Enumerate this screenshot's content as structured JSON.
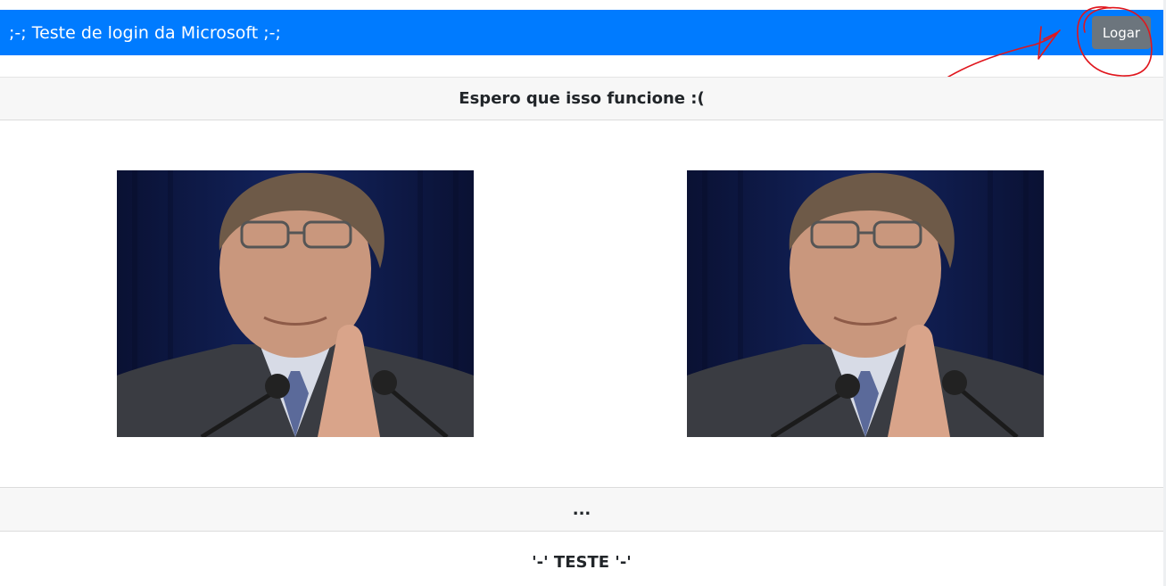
{
  "navbar": {
    "brand": ";-; Teste de login da Microsoft ;-;",
    "login_label": "Logar",
    "color": "#007bff"
  },
  "card": {
    "header": "Espero que isso funcione :(",
    "footer": "...",
    "bottom_text": "'-' TESTE '-'"
  },
  "images": [
    {
      "name": "portrait-left",
      "description": "man with glasses and hands pressed together in front of microphones"
    },
    {
      "name": "portrait-right",
      "description": "man with glasses and hands pressed together in front of microphones"
    }
  ],
  "annotation": {
    "color": "#e0161d",
    "icon": "red-circle-arrow"
  }
}
